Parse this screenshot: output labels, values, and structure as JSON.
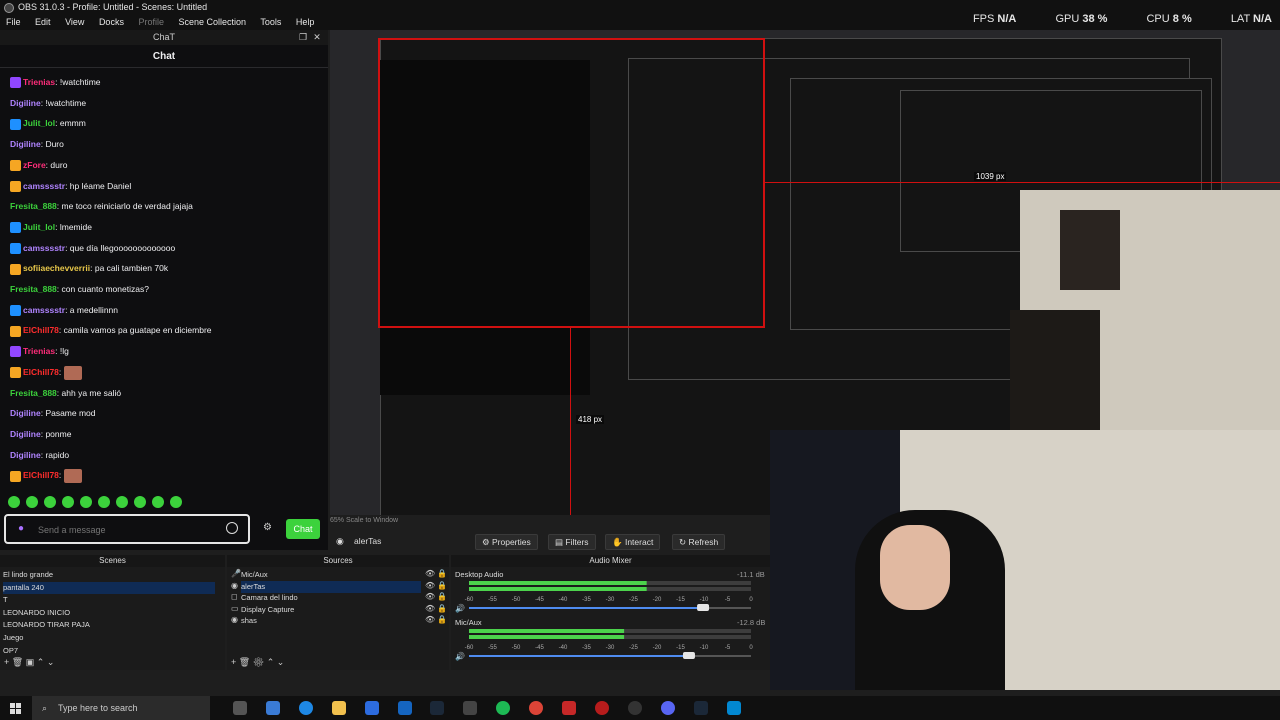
{
  "window": {
    "title": "OBS 31.0.3 - Profile: Untitled - Scenes: Untitled"
  },
  "menu": [
    "File",
    "Edit",
    "View",
    "Docks",
    "Profile",
    "Scene Collection",
    "Tools",
    "Help"
  ],
  "stats": {
    "fps_label": "FPS",
    "fps_value": "N/A",
    "gpu_label": "GPU",
    "gpu_value": "38 %",
    "cpu_label": "CPU",
    "cpu_value": "8 %",
    "lat_label": "LAT",
    "lat_value": "N/A"
  },
  "chat": {
    "dock_title": "ChaT",
    "header": "Chat",
    "messages": [
      {
        "user": "Trienias",
        "text": "!watchtime",
        "color": "#ff2d7a",
        "badge": "#9147ff"
      },
      {
        "user": "Digiline",
        "text": "!watchtime",
        "color": "#b084ff",
        "badge": ""
      },
      {
        "user": "Julit_lol",
        "text": "emmm",
        "color": "#3cd23c",
        "badge": "#1e90ff"
      },
      {
        "user": "Digiline",
        "text": "Duro",
        "color": "#b084ff",
        "badge": ""
      },
      {
        "user": "zFore",
        "text": "duro",
        "color": "#ff2d7a",
        "badge": "#f5a623"
      },
      {
        "user": "camsssstr",
        "text": "hp léame Daniel",
        "color": "#b084ff",
        "badge": "#f5a623"
      },
      {
        "user": "Fresita_888",
        "text": "me toco reiniciarlo de verdad jajaja",
        "color": "#3cd23c",
        "badge": ""
      },
      {
        "user": "Julit_lol",
        "text": "lmemide",
        "color": "#3cd23c",
        "badge": "#1e90ff"
      },
      {
        "user": "camsssstr",
        "text": "que día llegooooooooooooo",
        "color": "#b084ff",
        "badge": "#1e90ff"
      },
      {
        "user": "sofiiaechevverrii",
        "text": "pa cali tambien 70k",
        "color": "#e8c84a",
        "badge": "#f5a623"
      },
      {
        "user": "Fresita_888",
        "text": "con cuanto monetizas?",
        "color": "#3cd23c",
        "badge": ""
      },
      {
        "user": "camsssstr",
        "text": "a medellinnn",
        "color": "#b084ff",
        "badge": "#1e90ff"
      },
      {
        "user": "ElChill78",
        "text": "camila vamos pa guatape en diciembre",
        "color": "#ff2d2d",
        "badge": "#f5a623"
      },
      {
        "user": "Trienias",
        "text": "!lg",
        "color": "#ff2d7a",
        "badge": "#9147ff"
      },
      {
        "user": "ElChill78",
        "text": "",
        "color": "#ff2d2d",
        "badge": "#f5a623",
        "emote": true
      },
      {
        "user": "Fresita_888",
        "text": "ahh ya me salió",
        "color": "#3cd23c",
        "badge": ""
      },
      {
        "user": "Digiline",
        "text": "Pasame mod",
        "color": "#b084ff",
        "badge": ""
      },
      {
        "user": "Digiline",
        "text": "ponme",
        "color": "#b084ff",
        "badge": ""
      },
      {
        "user": "Digiline",
        "text": "rapido",
        "color": "#b084ff",
        "badge": ""
      },
      {
        "user": "ElChill78",
        "text": "",
        "color": "#ff2d2d",
        "badge": "#f5a623",
        "emote": true
      }
    ],
    "input_placeholder": "Send a message",
    "chat_button": "Chat"
  },
  "preview": {
    "measure_1": "1039 px",
    "measure_2": "418 px"
  },
  "source_toolbar": {
    "scale_info": "65% Scale to Window",
    "selected_source": "alerTas",
    "properties": "Properties",
    "filters": "Filters",
    "interact": "Interact",
    "refresh": "Refresh"
  },
  "scenes": {
    "title": "Scenes",
    "items": [
      "El lindo grande",
      "pantalla 240",
      "T",
      "LEONARDO INICIO",
      "LEONARDO TIRAR PAJA",
      "Juego",
      "OP7"
    ]
  },
  "sources": {
    "title": "Sources",
    "items": [
      "Mic/Aux",
      "alerTas",
      "Camara del lindo",
      "Display Capture",
      "shas"
    ]
  },
  "mixer": {
    "title": "Audio Mixer",
    "channels": [
      {
        "name": "Desktop Audio",
        "db": "-11.1 dB",
        "level": 0.63,
        "fader": 0.83
      },
      {
        "name": "Mic/Aux",
        "db": "-12.8 dB",
        "level": 0.55,
        "fader": 0.78
      }
    ],
    "scale": [
      "-60",
      "-55",
      "-50",
      "-45",
      "-40",
      "-35",
      "-30",
      "-25",
      "-20",
      "-15",
      "-10",
      "-5",
      "0"
    ]
  },
  "taskbar": {
    "search_placeholder": "Type here to search"
  }
}
